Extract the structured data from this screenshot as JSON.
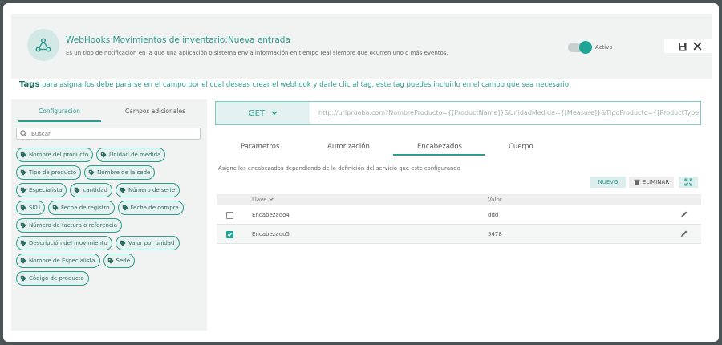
{
  "header": {
    "title": "WebHooks Movimientos de inventario:Nueva entrada",
    "subtitle": "Es un tipo de notificación en la que una aplicación o sistema envía información en tiempo real siempre que ocurren uno o más eventos.",
    "toggle_label": "Activo",
    "toggle_on": true
  },
  "tags_info": {
    "label": "Tags",
    "text": " para asignarlos debe pararse en el campo por el cual deseas crear el webhook y darle clic al tag, este tag puedes incluirlo en el campo que sea necesario"
  },
  "left_panel": {
    "tabs": [
      "Configuración",
      "Campos adicionales"
    ],
    "search_placeholder": "Buscar",
    "tags": [
      "Nombre del producto",
      "Unidad de medida",
      "Tipo de producto",
      "Nombre de la sede",
      "Especialista",
      "cantidad",
      "Número de serie",
      "SKU",
      "Fecha de registro",
      "Fecha de compra",
      "Número de factura o referencia",
      "Descripción del movimiento",
      "Valor por unidad",
      "Nombre de Especialista",
      "Sede",
      "Código de producto"
    ]
  },
  "request": {
    "method": "GET",
    "url": "http://urlprueba.com?NombreProducto={[ProductName]}&UnidadMedida={[Measure]}&TipoProducto={[ProductType]}&"
  },
  "tabs": [
    "Parámetros",
    "Autorización",
    "Encabezados",
    "Cuerpo"
  ],
  "active_tab": "Encabezados",
  "hint": "Asigne los encabezados dependiendo de la definición del servicio que este configurando",
  "buttons": {
    "new": "NUEVO",
    "delete": "ELIMINAR"
  },
  "table": {
    "columns": [
      "Llave",
      "Valor"
    ],
    "rows": [
      {
        "key": "Encabezado4",
        "value": "ddd",
        "checked": false
      },
      {
        "key": "Encabezado5",
        "value": "5478",
        "checked": true
      }
    ]
  },
  "colors": {
    "accent": "#2a9d8f",
    "accent_dark": "#1ea596"
  }
}
